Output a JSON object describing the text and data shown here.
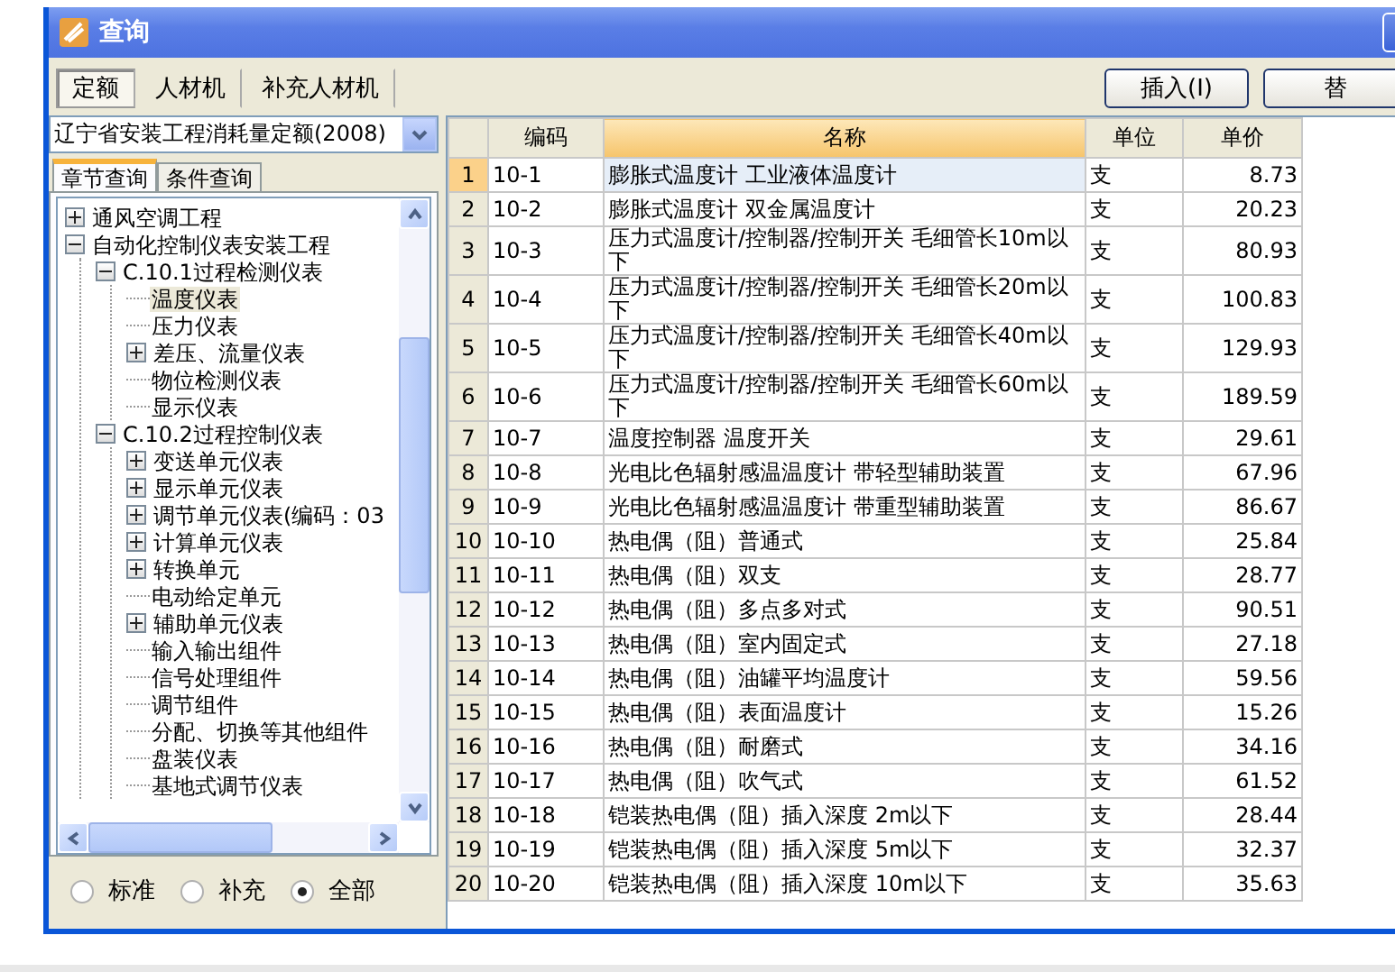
{
  "window": {
    "title": "查询"
  },
  "tabs": [
    {
      "label": "定额",
      "selected": true
    },
    {
      "label": "人材机",
      "selected": false
    },
    {
      "label": "补充人材机",
      "selected": false
    }
  ],
  "buttons": [
    "插入(I)",
    "替"
  ],
  "quota_select": {
    "value": "辽宁省安装工程消耗量定额(2008)"
  },
  "subtabs": [
    {
      "label": "章节查询",
      "selected": true
    },
    {
      "label": "条件查询",
      "selected": false
    }
  ],
  "tree": [
    {
      "label": "通风空调工程",
      "expanded": false,
      "selected": false
    },
    {
      "label": "自动化控制仪表安装工程",
      "expanded": true,
      "selected": false,
      "children": [
        {
          "label": "C.10.1过程检测仪表",
          "expanded": true,
          "selected": false,
          "children": [
            {
              "label": "温度仪表",
              "selected": true
            },
            {
              "label": "压力仪表",
              "selected": false
            },
            {
              "label": "差压、流量仪表",
              "expanded": false,
              "selected": false
            },
            {
              "label": "物位检测仪表",
              "selected": false
            },
            {
              "label": "显示仪表",
              "selected": false
            }
          ]
        },
        {
          "label": "C.10.2过程控制仪表",
          "expanded": true,
          "selected": false,
          "children": [
            {
              "label": "变送单元仪表",
              "expanded": false,
              "selected": false
            },
            {
              "label": "显示单元仪表",
              "expanded": false,
              "selected": false
            },
            {
              "label": "调节单元仪表(编码：03",
              "expanded": false,
              "selected": false
            },
            {
              "label": "计算单元仪表",
              "expanded": false,
              "selected": false
            },
            {
              "label": "转换单元",
              "expanded": false,
              "selected": false
            },
            {
              "label": "电动给定单元",
              "selected": false
            },
            {
              "label": "辅助单元仪表",
              "expanded": false,
              "selected": false
            },
            {
              "label": "输入输出组件",
              "selected": false
            },
            {
              "label": "信号处理组件",
              "selected": false
            },
            {
              "label": "调节组件",
              "selected": false
            },
            {
              "label": "分配、切换等其他组件",
              "selected": false
            },
            {
              "label": "盘装仪表",
              "selected": false
            },
            {
              "label": "基地式调节仪表",
              "selected": false
            }
          ]
        }
      ]
    }
  ],
  "filters": [
    {
      "label": "标准",
      "selected": false
    },
    {
      "label": "补充",
      "selected": false
    },
    {
      "label": "全部",
      "selected": true
    }
  ],
  "table": {
    "columns": [
      "编码",
      "名称",
      "单位",
      "单价"
    ],
    "rows": [
      {
        "no": "1",
        "code": "10-1",
        "name": "膨胀式温度计 工业液体温度计",
        "unit": "支",
        "price": "8.73",
        "selected": true
      },
      {
        "no": "2",
        "code": "10-2",
        "name": "膨胀式温度计 双金属温度计",
        "unit": "支",
        "price": "20.23",
        "selected": false
      },
      {
        "no": "3",
        "code": "10-3",
        "name": "压力式温度计/控制器/控制开关 毛细管长10m以下",
        "unit": "支",
        "price": "80.93",
        "selected": false
      },
      {
        "no": "4",
        "code": "10-4",
        "name": "压力式温度计/控制器/控制开关 毛细管长20m以下",
        "unit": "支",
        "price": "100.83",
        "selected": false
      },
      {
        "no": "5",
        "code": "10-5",
        "name": "压力式温度计/控制器/控制开关 毛细管长40m以下",
        "unit": "支",
        "price": "129.93",
        "selected": false
      },
      {
        "no": "6",
        "code": "10-6",
        "name": "压力式温度计/控制器/控制开关 毛细管长60m以下",
        "unit": "支",
        "price": "189.59",
        "selected": false
      },
      {
        "no": "7",
        "code": "10-7",
        "name": "温度控制器 温度开关",
        "unit": "支",
        "price": "29.61",
        "selected": false
      },
      {
        "no": "8",
        "code": "10-8",
        "name": "光电比色辐射感温温度计 带轻型辅助装置",
        "unit": "支",
        "price": "67.96",
        "selected": false
      },
      {
        "no": "9",
        "code": "10-9",
        "name": "光电比色辐射感温温度计 带重型辅助装置",
        "unit": "支",
        "price": "86.67",
        "selected": false
      },
      {
        "no": "10",
        "code": "10-10",
        "name": "热电偶（阻）普通式",
        "unit": "支",
        "price": "25.84",
        "selected": false
      },
      {
        "no": "11",
        "code": "10-11",
        "name": "热电偶（阻）双支",
        "unit": "支",
        "price": "28.77",
        "selected": false
      },
      {
        "no": "12",
        "code": "10-12",
        "name": "热电偶（阻）多点多对式",
        "unit": "支",
        "price": "90.51",
        "selected": false
      },
      {
        "no": "13",
        "code": "10-13",
        "name": "热电偶（阻）室内固定式",
        "unit": "支",
        "price": "27.18",
        "selected": false
      },
      {
        "no": "14",
        "code": "10-14",
        "name": "热电偶（阻）油罐平均温度计",
        "unit": "支",
        "price": "59.56",
        "selected": false
      },
      {
        "no": "15",
        "code": "10-15",
        "name": "热电偶（阻）表面温度计",
        "unit": "支",
        "price": "15.26",
        "selected": false
      },
      {
        "no": "16",
        "code": "10-16",
        "name": "热电偶（阻）耐磨式",
        "unit": "支",
        "price": "34.16",
        "selected": false
      },
      {
        "no": "17",
        "code": "10-17",
        "name": "热电偶（阻）吹气式",
        "unit": "支",
        "price": "61.52",
        "selected": false
      },
      {
        "no": "18",
        "code": "10-18",
        "name": "铠装热电偶（阻）插入深度 2m以下",
        "unit": "支",
        "price": "28.44",
        "selected": false
      },
      {
        "no": "19",
        "code": "10-19",
        "name": "铠装热电偶（阻）插入深度 5m以下",
        "unit": "支",
        "price": "32.37",
        "selected": false
      },
      {
        "no": "20",
        "code": "10-20",
        "name": "铠装热电偶（阻）插入深度 10m以下",
        "unit": "支",
        "price": "35.63",
        "selected": false
      }
    ]
  }
}
